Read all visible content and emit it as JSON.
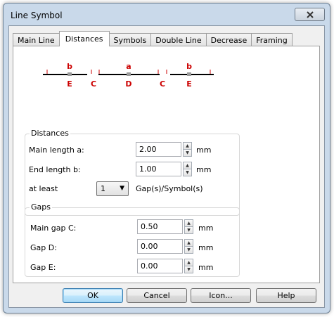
{
  "window": {
    "title": "Line Symbol",
    "close_icon": "close-icon"
  },
  "tabs": [
    "Main Line",
    "Distances",
    "Symbols",
    "Double Line",
    "Decrease",
    "Framing"
  ],
  "active_tab": "Distances",
  "diagram": {
    "top_labels": [
      "b",
      "a",
      "b"
    ],
    "bottom_labels": [
      "E",
      "C",
      "D",
      "C",
      "E"
    ],
    "accent_color": "#cc0000"
  },
  "distances": {
    "title": "Distances",
    "main_length_label": "Main length a:",
    "main_length_value": "2.00",
    "end_length_label": "End length b:",
    "end_length_value": "1.00",
    "at_least_label": "at least",
    "at_least_value": "1",
    "gaps_symbols_label": "Gap(s)/Symbol(s)",
    "unit": "mm"
  },
  "gaps": {
    "title": "Gaps",
    "main_gap_label": "Main gap C:",
    "main_gap_value": "0.50",
    "gap_d_label": "Gap D:",
    "gap_d_value": "0.00",
    "gap_e_label": "Gap E:",
    "gap_e_value": "0.00",
    "unit": "mm"
  },
  "buttons": {
    "ok": "OK",
    "cancel": "Cancel",
    "icon": "Icon...",
    "help": "Help"
  }
}
